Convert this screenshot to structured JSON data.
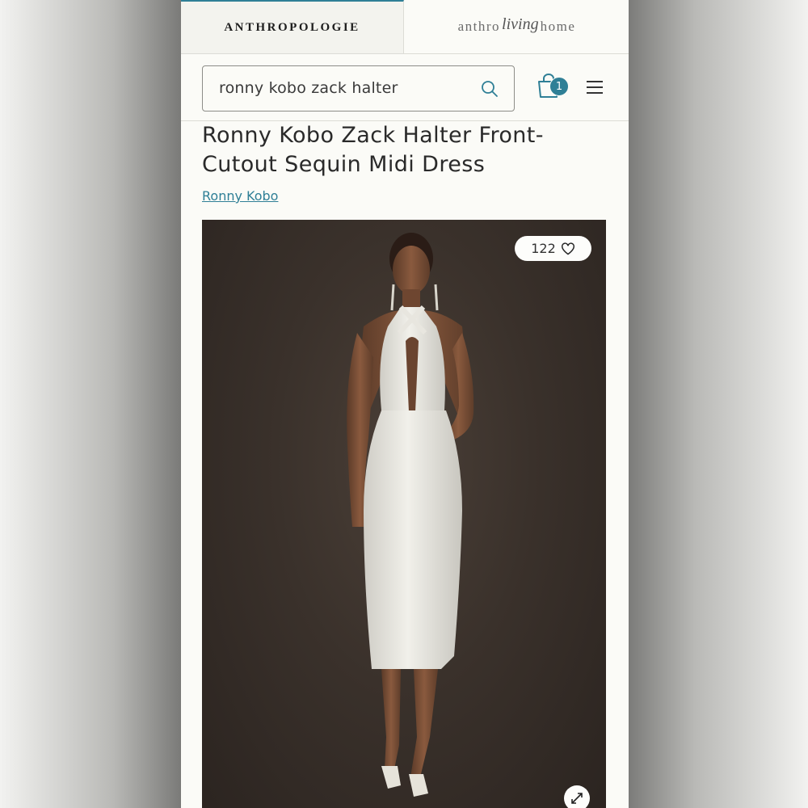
{
  "brand_tabs": {
    "anthropologie": "ANTHROPOLOGIE",
    "living_prefix": "anthro",
    "living_script": "living",
    "living_suffix": "home"
  },
  "search": {
    "value": "ronny kobo zack halter"
  },
  "cart": {
    "count": "1"
  },
  "product": {
    "title_line1": "Ronny Kobo Zack Halter Front-",
    "title_line2": "Cutout Sequin Midi Dress",
    "brand": "Ronny Kobo",
    "likes": "122",
    "image_alt": "Model wearing white sequin halter midi dress"
  },
  "colors": {
    "accent": "#2f7f96",
    "background": "#fbfbf7",
    "photo_backdrop": "#3a312b",
    "dress": "#ecebe6"
  },
  "icons": {
    "search": "search-icon",
    "cart": "shopping-bag-icon",
    "menu": "hamburger-menu-icon",
    "like": "heart-icon",
    "expand": "expand-icon"
  }
}
